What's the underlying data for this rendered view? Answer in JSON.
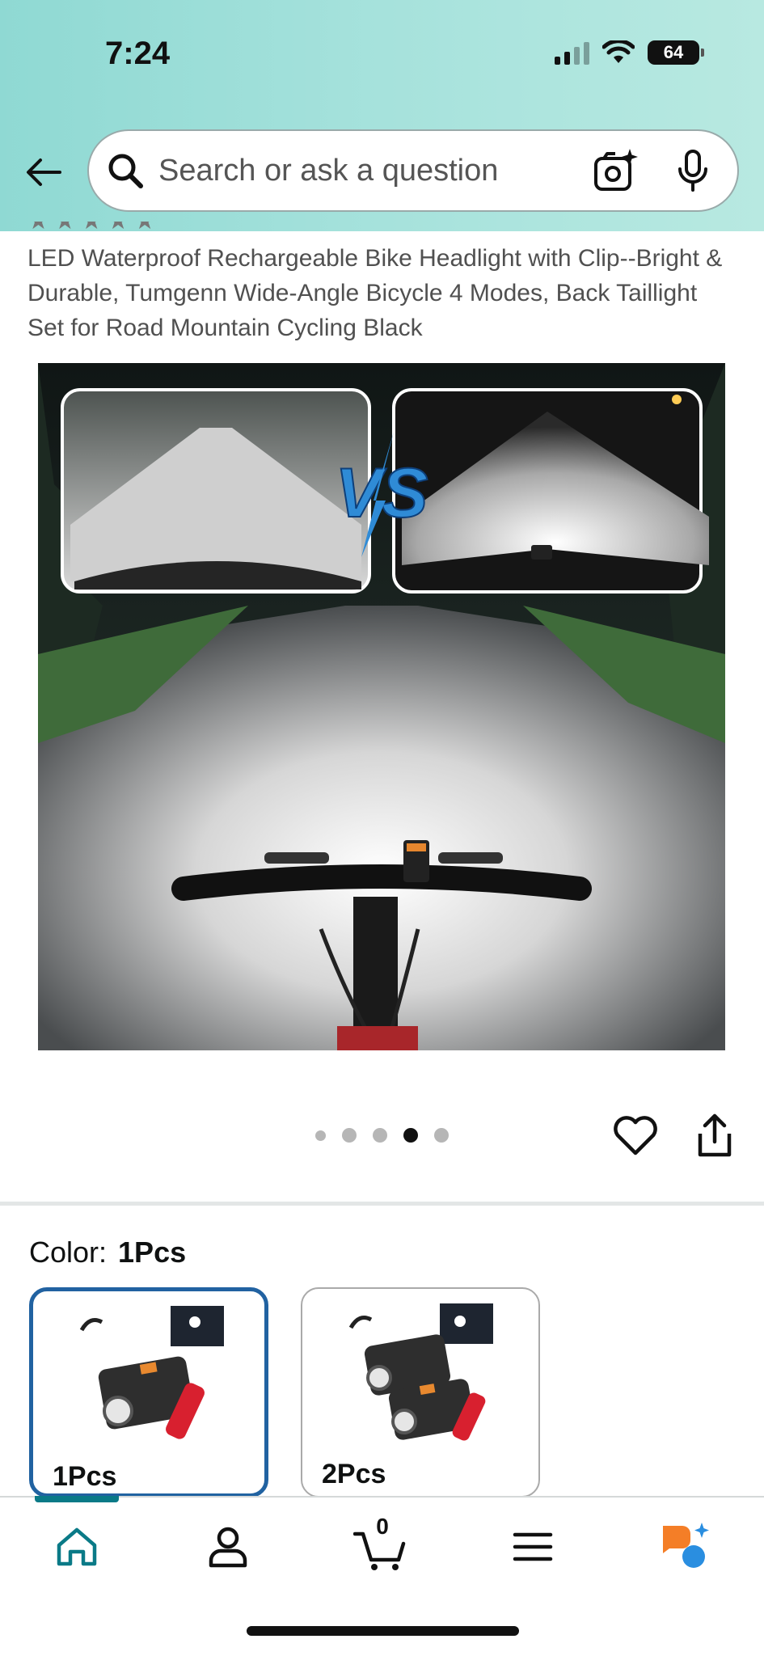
{
  "status_bar": {
    "time": "7:24",
    "battery": "64"
  },
  "search": {
    "placeholder": "Search or ask a question"
  },
  "product": {
    "title": "LED Waterproof Rechargeable Bike Headlight with Clip--Bright & Durable,   Tumgenn Wide-Angle Bicycle 4 Modes, Back Taillight Set for Road Mountain Cycling Black",
    "image_badge": "VS",
    "carousel": {
      "total": 5,
      "active_index": 3
    }
  },
  "color": {
    "label": "Color:",
    "selected": "1Pcs",
    "options": [
      {
        "label": "1Pcs",
        "selected": true
      },
      {
        "label": "2Pcs",
        "selected": false
      }
    ]
  },
  "bottom_nav": {
    "items": [
      {
        "name": "home",
        "icon": "home-icon",
        "active": true
      },
      {
        "name": "account",
        "icon": "person-icon",
        "active": false
      },
      {
        "name": "cart",
        "icon": "cart-icon",
        "active": false
      },
      {
        "name": "menu",
        "icon": "menu-icon",
        "active": false
      },
      {
        "name": "rufus",
        "icon": "ai-assistant-icon",
        "active": false
      }
    ],
    "cart_count": "0"
  },
  "colors": {
    "accent": "#0a7a87",
    "selected_border": "#2162a1"
  }
}
